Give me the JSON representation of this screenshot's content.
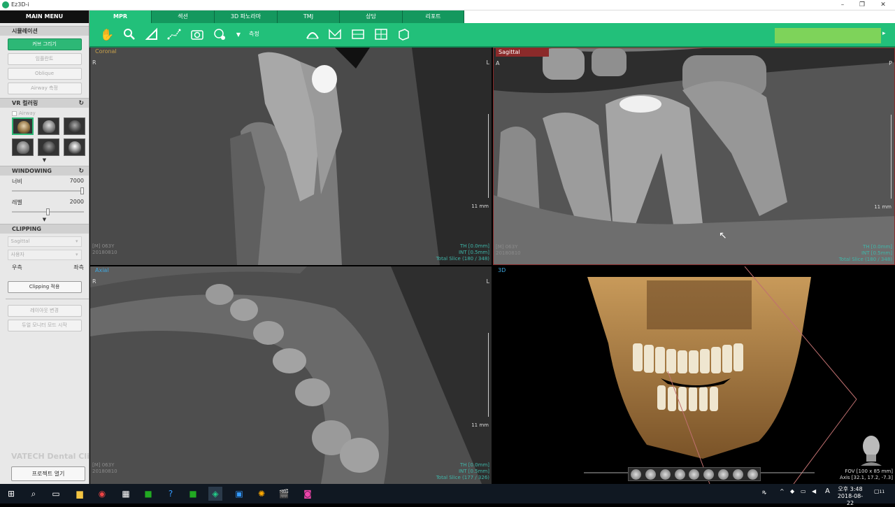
{
  "window": {
    "title": "Ez3D-i"
  },
  "sidebar": {
    "main_menu": "MAIN MENU",
    "simulation": {
      "title": "시뮬레이션",
      "buttons": [
        "커브 그리기",
        "임플란트",
        "Oblique",
        "Airway 측정"
      ]
    },
    "vr_coloring": {
      "title": "VR 컬러링",
      "airway_label": "Airway"
    },
    "windowing": {
      "title": "WINDOWING",
      "width_label": "너비",
      "width_value": "7000",
      "level_label": "레벨",
      "level_value": "2000",
      "width_fraction": 1.0,
      "level_fraction": 0.5
    },
    "clipping": {
      "title": "CLIPPING",
      "plane": "Sagittal",
      "mode": "사용자",
      "left_label": "우측",
      "right_label": "좌측",
      "apply_button": "Clipping 적용"
    },
    "extra_buttons": [
      "레이아웃 변경",
      "듀얼 모니터 모드 시작"
    ],
    "clinic_text": "VATECH Dental Clinic",
    "open_project": "프로젝트 열기"
  },
  "tabs": [
    "MPR",
    "섹션",
    "3D 파노라마",
    "TMJ",
    "상담",
    "리포트"
  ],
  "toolbar": {
    "measure_label": "측정"
  },
  "views": {
    "coronal": {
      "label": "Coronal",
      "left": "R",
      "right": "L",
      "info1": "[M] 063Y",
      "info2": "20180810",
      "scale": "11 mm",
      "th": "TH [0.0mm]",
      "int": "INT [0.5mm]",
      "total": "Total Slice (180 / 348)"
    },
    "sagittal": {
      "label": "Sagittal",
      "left": "A",
      "right": "P",
      "info1": "[M] 063Y",
      "info2": "20180810",
      "scale": "11 mm",
      "th": "TH [0.0mm]",
      "int": "INT [0.5mm]",
      "total": "Total Slice (180 / 348)"
    },
    "axial": {
      "label": "Axial",
      "left": "R",
      "right": "L",
      "info1": "[M] 063Y",
      "info2": "20180810",
      "scale": "11 mm",
      "th": "TH [0.0mm]",
      "int": "INT [0.5mm]",
      "total": "Total Slice (177 / 326)"
    },
    "v3d": {
      "label": "3D",
      "fov": "FOV [100 x 85 mm]",
      "axis": "Axis [32.1, 17.2, -7.3]"
    }
  },
  "taskbar": {
    "time": "오후 3:48",
    "date": "2018-08-22",
    "ime": "A",
    "notifications": "11"
  },
  "colors": {
    "accent": "#22c07a",
    "tab_dark": "#14985e",
    "sagittal_label": "#8b2a2a",
    "info_cyan": "#3fb7aa"
  }
}
